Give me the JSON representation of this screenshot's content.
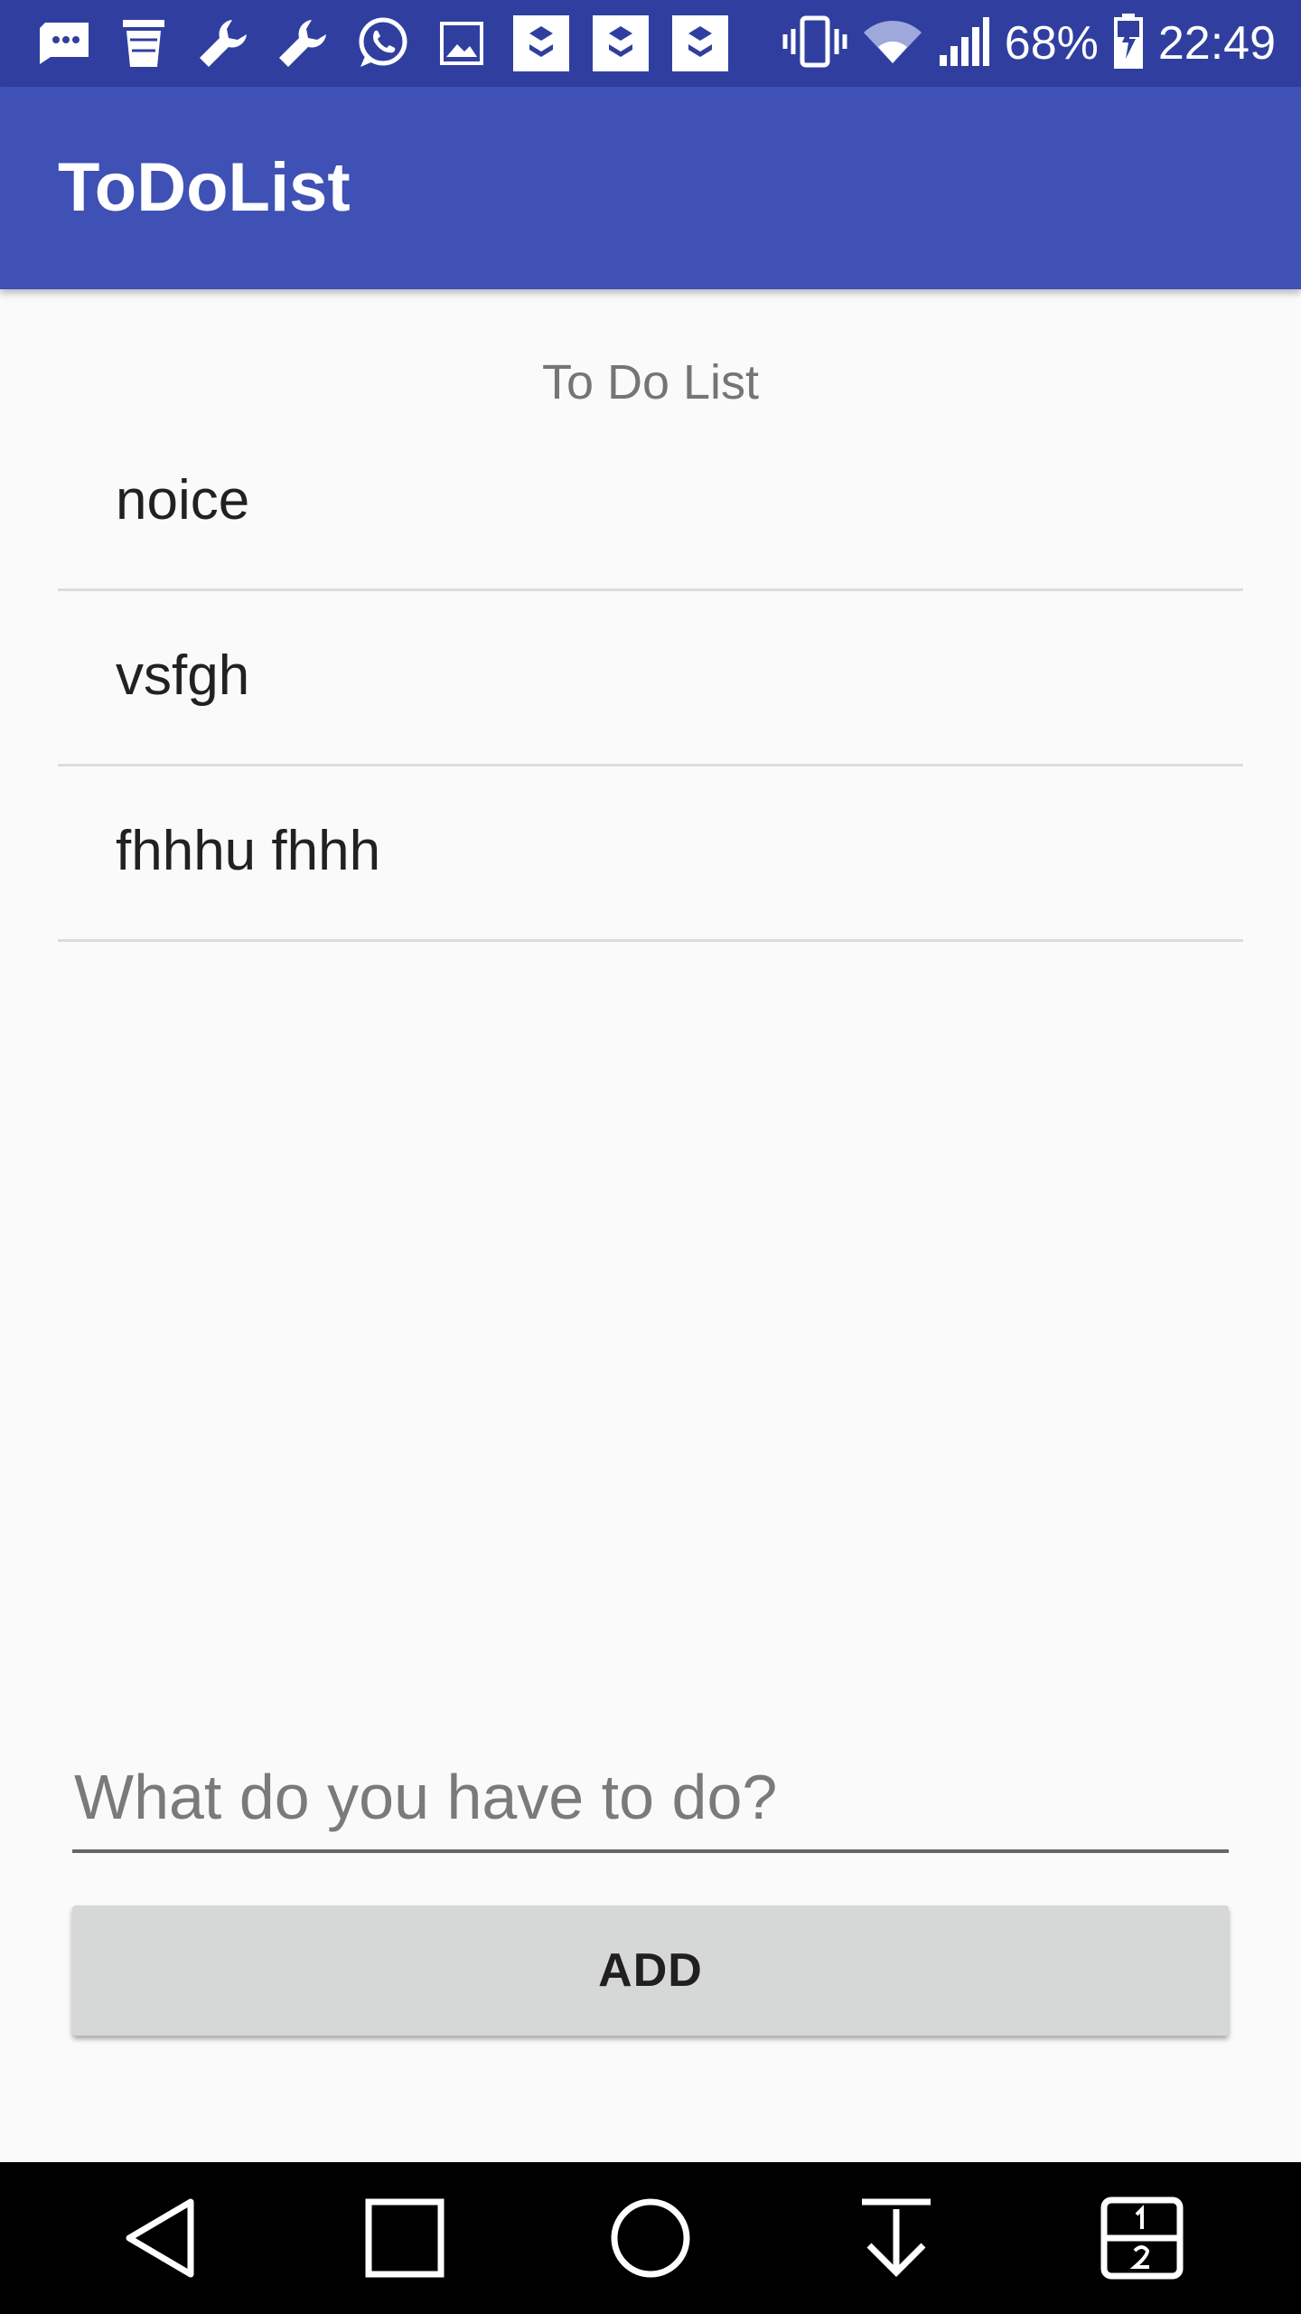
{
  "status_bar": {
    "icons": [
      "message-icon",
      "trash-icon",
      "wrench-icon",
      "wrench-icon",
      "whatsapp-icon",
      "image-icon",
      "app-badge-icon",
      "app-badge-icon",
      "app-badge-icon"
    ],
    "right_icons": [
      "vibrate-icon",
      "wifi-icon",
      "signal-icon",
      "battery-charging-icon"
    ],
    "battery": "68%",
    "time": "22:49"
  },
  "app_bar": {
    "title": "ToDoList"
  },
  "list": {
    "header": "To Do List",
    "items": [
      {
        "text": "noice"
      },
      {
        "text": "vsfgh"
      },
      {
        "text": "fhhhu fhhh"
      }
    ]
  },
  "input": {
    "placeholder": "What do you have to do?",
    "value": ""
  },
  "add_button": {
    "label": "ADD"
  },
  "nav_bar": {
    "buttons": [
      "back-icon",
      "recents-icon",
      "home-icon",
      "notification-pull-icon",
      "dual-window-icon"
    ]
  },
  "colors": {
    "status_bar": "#303f9f",
    "app_bar": "#3f51b5",
    "background": "#fafafa",
    "button": "#d6d7d7",
    "nav_bar": "#000000"
  }
}
